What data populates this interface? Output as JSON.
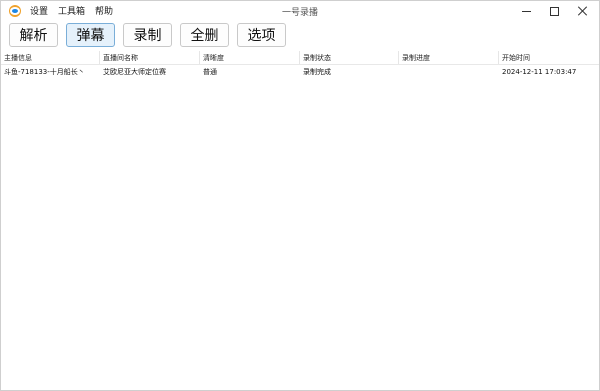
{
  "window": {
    "title": "一号录播"
  },
  "menu": {
    "items": [
      "设置",
      "工具箱",
      "帮助"
    ]
  },
  "toolbar": {
    "parse_label": "解析",
    "danmaku_label": "弹幕",
    "record_label": "录制",
    "delete_all_label": "全删",
    "options_label": "选项"
  },
  "table": {
    "headers": [
      "主播信息",
      "直播间名称",
      "清晰度",
      "录制状态",
      "录制进度",
      "开始时间"
    ],
    "rows": [
      [
        "斗鱼-718133-十月船长丶",
        "艾欧尼亚大师定位赛",
        "普通",
        "录制完成",
        "",
        "2024-12-11 17:03:47"
      ]
    ]
  },
  "colors": {
    "active_button_bg": "#e5f1fb",
    "active_button_border": "#7aaed8"
  },
  "icons": [
    "app-logo-icon",
    "minimize-icon",
    "maximize-icon",
    "close-icon"
  ]
}
